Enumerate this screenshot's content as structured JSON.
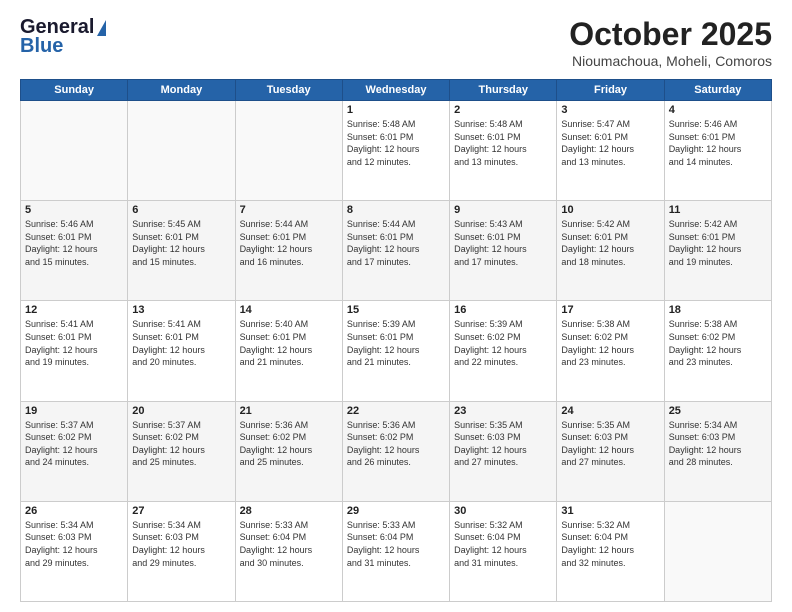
{
  "logo": {
    "line1": "General",
    "line2": "Blue"
  },
  "title": "October 2025",
  "location": "Nioumachoua, Moheli, Comoros",
  "days_of_week": [
    "Sunday",
    "Monday",
    "Tuesday",
    "Wednesday",
    "Thursday",
    "Friday",
    "Saturday"
  ],
  "weeks": [
    [
      {
        "day": "",
        "info": ""
      },
      {
        "day": "",
        "info": ""
      },
      {
        "day": "",
        "info": ""
      },
      {
        "day": "1",
        "info": "Sunrise: 5:48 AM\nSunset: 6:01 PM\nDaylight: 12 hours\nand 12 minutes."
      },
      {
        "day": "2",
        "info": "Sunrise: 5:48 AM\nSunset: 6:01 PM\nDaylight: 12 hours\nand 13 minutes."
      },
      {
        "day": "3",
        "info": "Sunrise: 5:47 AM\nSunset: 6:01 PM\nDaylight: 12 hours\nand 13 minutes."
      },
      {
        "day": "4",
        "info": "Sunrise: 5:46 AM\nSunset: 6:01 PM\nDaylight: 12 hours\nand 14 minutes."
      }
    ],
    [
      {
        "day": "5",
        "info": "Sunrise: 5:46 AM\nSunset: 6:01 PM\nDaylight: 12 hours\nand 15 minutes."
      },
      {
        "day": "6",
        "info": "Sunrise: 5:45 AM\nSunset: 6:01 PM\nDaylight: 12 hours\nand 15 minutes."
      },
      {
        "day": "7",
        "info": "Sunrise: 5:44 AM\nSunset: 6:01 PM\nDaylight: 12 hours\nand 16 minutes."
      },
      {
        "day": "8",
        "info": "Sunrise: 5:44 AM\nSunset: 6:01 PM\nDaylight: 12 hours\nand 17 minutes."
      },
      {
        "day": "9",
        "info": "Sunrise: 5:43 AM\nSunset: 6:01 PM\nDaylight: 12 hours\nand 17 minutes."
      },
      {
        "day": "10",
        "info": "Sunrise: 5:42 AM\nSunset: 6:01 PM\nDaylight: 12 hours\nand 18 minutes."
      },
      {
        "day": "11",
        "info": "Sunrise: 5:42 AM\nSunset: 6:01 PM\nDaylight: 12 hours\nand 19 minutes."
      }
    ],
    [
      {
        "day": "12",
        "info": "Sunrise: 5:41 AM\nSunset: 6:01 PM\nDaylight: 12 hours\nand 19 minutes."
      },
      {
        "day": "13",
        "info": "Sunrise: 5:41 AM\nSunset: 6:01 PM\nDaylight: 12 hours\nand 20 minutes."
      },
      {
        "day": "14",
        "info": "Sunrise: 5:40 AM\nSunset: 6:01 PM\nDaylight: 12 hours\nand 21 minutes."
      },
      {
        "day": "15",
        "info": "Sunrise: 5:39 AM\nSunset: 6:01 PM\nDaylight: 12 hours\nand 21 minutes."
      },
      {
        "day": "16",
        "info": "Sunrise: 5:39 AM\nSunset: 6:02 PM\nDaylight: 12 hours\nand 22 minutes."
      },
      {
        "day": "17",
        "info": "Sunrise: 5:38 AM\nSunset: 6:02 PM\nDaylight: 12 hours\nand 23 minutes."
      },
      {
        "day": "18",
        "info": "Sunrise: 5:38 AM\nSunset: 6:02 PM\nDaylight: 12 hours\nand 23 minutes."
      }
    ],
    [
      {
        "day": "19",
        "info": "Sunrise: 5:37 AM\nSunset: 6:02 PM\nDaylight: 12 hours\nand 24 minutes."
      },
      {
        "day": "20",
        "info": "Sunrise: 5:37 AM\nSunset: 6:02 PM\nDaylight: 12 hours\nand 25 minutes."
      },
      {
        "day": "21",
        "info": "Sunrise: 5:36 AM\nSunset: 6:02 PM\nDaylight: 12 hours\nand 25 minutes."
      },
      {
        "day": "22",
        "info": "Sunrise: 5:36 AM\nSunset: 6:02 PM\nDaylight: 12 hours\nand 26 minutes."
      },
      {
        "day": "23",
        "info": "Sunrise: 5:35 AM\nSunset: 6:03 PM\nDaylight: 12 hours\nand 27 minutes."
      },
      {
        "day": "24",
        "info": "Sunrise: 5:35 AM\nSunset: 6:03 PM\nDaylight: 12 hours\nand 27 minutes."
      },
      {
        "day": "25",
        "info": "Sunrise: 5:34 AM\nSunset: 6:03 PM\nDaylight: 12 hours\nand 28 minutes."
      }
    ],
    [
      {
        "day": "26",
        "info": "Sunrise: 5:34 AM\nSunset: 6:03 PM\nDaylight: 12 hours\nand 29 minutes."
      },
      {
        "day": "27",
        "info": "Sunrise: 5:34 AM\nSunset: 6:03 PM\nDaylight: 12 hours\nand 29 minutes."
      },
      {
        "day": "28",
        "info": "Sunrise: 5:33 AM\nSunset: 6:04 PM\nDaylight: 12 hours\nand 30 minutes."
      },
      {
        "day": "29",
        "info": "Sunrise: 5:33 AM\nSunset: 6:04 PM\nDaylight: 12 hours\nand 31 minutes."
      },
      {
        "day": "30",
        "info": "Sunrise: 5:32 AM\nSunset: 6:04 PM\nDaylight: 12 hours\nand 31 minutes."
      },
      {
        "day": "31",
        "info": "Sunrise: 5:32 AM\nSunset: 6:04 PM\nDaylight: 12 hours\nand 32 minutes."
      },
      {
        "day": "",
        "info": ""
      }
    ]
  ]
}
